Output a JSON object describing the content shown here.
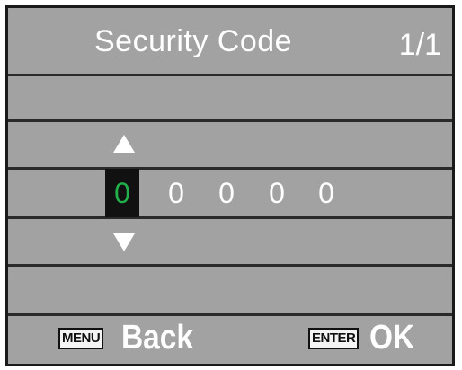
{
  "header": {
    "title": "Security Code",
    "page_indicator": "1/1"
  },
  "code_entry": {
    "digits": [
      "0",
      "0",
      "0",
      "0",
      "0"
    ],
    "selected_index": 0,
    "up_icon": "triangle-up-icon",
    "down_icon": "triangle-down-icon"
  },
  "footer": {
    "back_key_label": "MENU",
    "back_action": "Back",
    "ok_key_label": "ENTER",
    "ok_action": "OK"
  },
  "colors": {
    "background": "#a2a2a2",
    "text": "#ffffff",
    "selected_digit": "#22b04a",
    "selected_bg": "#111111",
    "divider": "#2a2a2a"
  }
}
